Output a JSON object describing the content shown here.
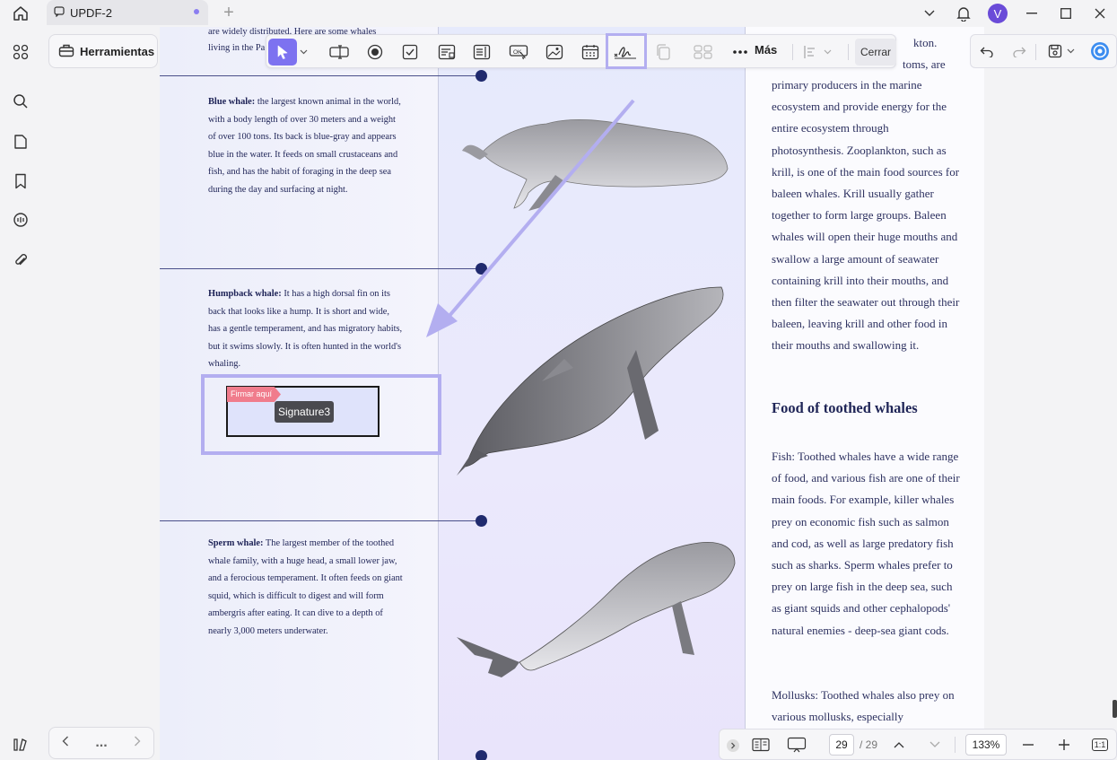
{
  "window": {
    "tab_title": "UPDF-2",
    "avatar_letter": "V",
    "accent_color": "#7d72f0"
  },
  "tools_panel": {
    "label": "Herramientas"
  },
  "toolbar": {
    "more_label": "Más",
    "close_label": "Cerrar",
    "text_field_icon": "OK"
  },
  "document": {
    "top_fragment_1": "are widely distributed. Here are some whales",
    "top_fragment_2": "living in the Pa",
    "blue_whale_title": "Blue whale:",
    "blue_whale_text": "the largest known animal in the world, with a body length of over 30 meters and a weight of over 100 tons. Its back is blue-gray and appears blue in the water. It feeds on small crustaceans and fish, and has the habit of foraging in the deep sea during the day and surfacing at night.",
    "humpback_title": "Humpback whale:",
    "humpback_text": "It has a high dorsal fin on its back that looks like a hump. It is short and wide, has a gentle temperament, and has migratory habits, but it swims slowly. It is often hunted in the world's whaling.",
    "sperm_title": "Sperm whale:",
    "sperm_text": "The largest member of the toothed whale family, with a huge head, a small lower jaw, and a ferocious temperament. It often feeds on giant squid, which is difficult to digest and will form ambergris after eating. It can dive to a depth of nearly 3,000 meters underwater.",
    "right_top_1": "kton.",
    "right_top_2": "toms, are",
    "right_para_1": "primary producers in the marine ecosystem and provide energy for the entire ecosystem through photosynthesis. Zooplankton, such as krill, is one of the main food sources for baleen whales. Krill usually gather together to form large groups. Baleen whales will open their huge mouths and swallow a large amount of seawater containing krill into their mouths, and then filter the seawater out through their baleen, leaving krill and other food in their mouths and swallowing it.",
    "right_heading": "Food of toothed whales",
    "right_para_2": "Fish: Toothed whales have a wide range of food, and various fish are one of their main foods. For example, killer whales prey on economic fish such as salmon and cod, as well as large predatory fish such as sharks. Sperm whales prefer to prey on large fish in the deep sea, such as giant squids and other cephalopods' natural enemies - deep-sea giant cods.",
    "right_para_3": "Mollusks: Toothed whales also prey on various mollusks, especially"
  },
  "signature": {
    "tag_label": "Firmar aquí",
    "field_name": "Signature3"
  },
  "bottom_bar": {
    "current_page": "29",
    "total_pages": "/ 29",
    "zoom": "133%",
    "fit_label": "1:1"
  },
  "nav_bar": {
    "more": "..."
  }
}
